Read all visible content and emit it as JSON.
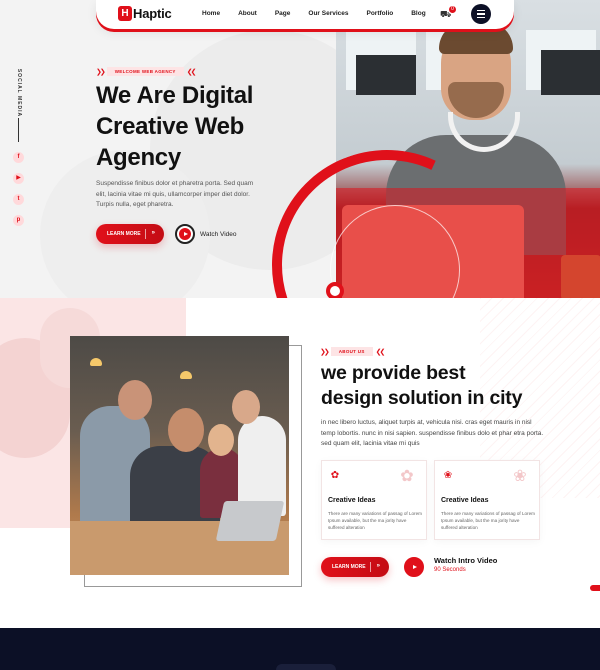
{
  "brand": {
    "logo_mark": "H",
    "name": "Haptic"
  },
  "nav": {
    "items": [
      {
        "label": "Home"
      },
      {
        "label": "About"
      },
      {
        "label": "Page"
      },
      {
        "label": "Our Services"
      },
      {
        "label": "Portfolio"
      },
      {
        "label": "Blog"
      }
    ],
    "cart_icon": "cart-icon",
    "cart_count": "0",
    "menu_icon": "hamburger-icon"
  },
  "social": {
    "label": "SOCIAL MEDIA",
    "icons": [
      {
        "name": "facebook-icon",
        "glyph": "f"
      },
      {
        "name": "youtube-icon",
        "glyph": "▶"
      },
      {
        "name": "twitter-icon",
        "glyph": "t"
      },
      {
        "name": "pinterest-icon",
        "glyph": "p"
      }
    ]
  },
  "hero": {
    "tag": "WELCOME WEB AGENCY",
    "title_line1": "We Are Digital",
    "title_line2": "Creative Web",
    "title_line3": "Agency",
    "description": "Suspendisse finibus dolor et pharetra porta. Sed quam elit, lacinia vitae mi quis, ullamcorper imper diet dolor. Turpis nulla, eget pharetra.",
    "cta_label": "LEARN MORE",
    "video_label": "Watch Video"
  },
  "about": {
    "tag": "ABOUT US",
    "title_line1": "we provide best",
    "title_line2": "design solution in city",
    "description": "in nec libero luctus, aliquet turpis at, vehicula nisi. cras eget mauris in nisl temp lobortis. nunc in nisi sapien. suspendisse finibus dolo et phar etra porta. sed quam elit, lacinia vitae mi quis",
    "cards": [
      {
        "title": "Creative Ideas",
        "text": "There are many variations of passag of Lorem Ipsum available, but the ma jority have suffered alteration"
      },
      {
        "title": "Creative Ideas",
        "text": "There are many variations of passag of Lorem Ipsum available, but the ma jority have suffered alteration"
      }
    ],
    "cta_label": "LEARN MORE",
    "intro_title": "Watch Intro Video",
    "intro_sub": "90 Seconds"
  },
  "colors": {
    "accent": "#e0101a",
    "dark": "#0c1026",
    "blush": "#fbe5e5"
  }
}
